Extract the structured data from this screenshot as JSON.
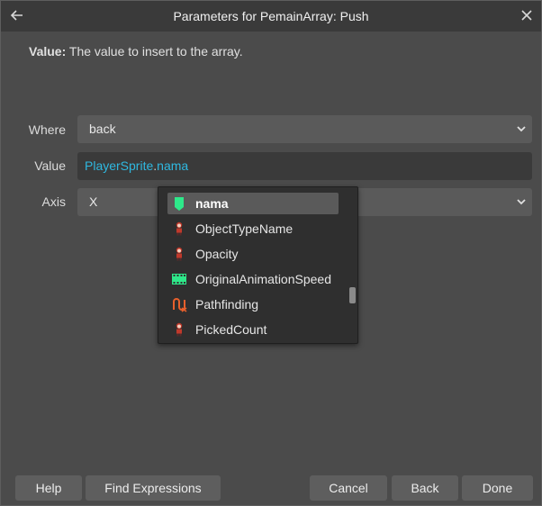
{
  "dialog": {
    "title": "Parameters for PemainArray: Push",
    "description_label": "Value:",
    "description_text": "The value to insert to the array."
  },
  "params": {
    "where": {
      "label": "Where",
      "value": "back"
    },
    "value": {
      "label": "Value",
      "object": "PlayerSprite",
      "dot": ".",
      "function": "nama"
    },
    "axis": {
      "label": "Axis",
      "value": "X"
    }
  },
  "autocomplete": {
    "items": [
      {
        "label": "nama",
        "icon": "variable-tag-icon",
        "selected": true
      },
      {
        "label": "ObjectTypeName",
        "icon": "sprite-character-icon",
        "selected": false
      },
      {
        "label": "Opacity",
        "icon": "sprite-character-icon",
        "selected": false
      },
      {
        "label": "OriginalAnimationSpeed",
        "icon": "film-strip-icon",
        "selected": false
      },
      {
        "label": "Pathfinding",
        "icon": "pathfinding-icon",
        "selected": false
      },
      {
        "label": "PickedCount",
        "icon": "sprite-character-icon",
        "selected": false
      }
    ]
  },
  "buttons": {
    "help": "Help",
    "find_expressions": "Find Expressions",
    "cancel": "Cancel",
    "back": "Back",
    "done": "Done"
  },
  "colors": {
    "background": "#4b4b4b",
    "titlebar": "#3a3a3a",
    "expression_accent": "#2fb8e0",
    "variable_icon": "#2ee88a",
    "pathfinding_icon": "#e8602c"
  }
}
